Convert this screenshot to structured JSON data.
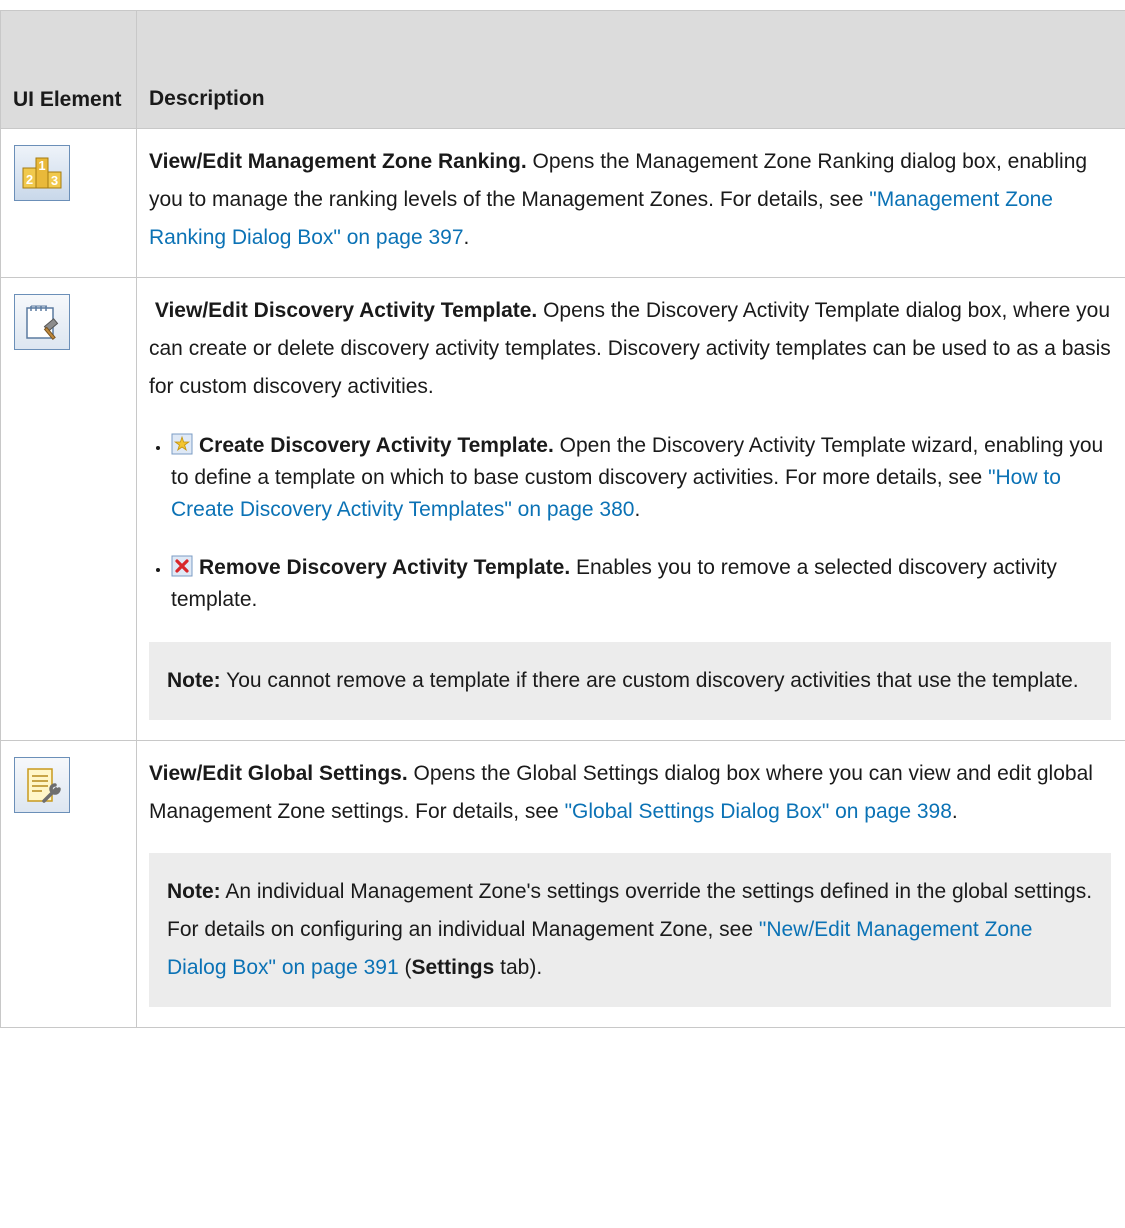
{
  "header": {
    "col1": "UI Element",
    "col2": "Description"
  },
  "rows": [
    {
      "icon": "ranking-icon",
      "title": "View/Edit Management Zone Ranking.",
      "text": " Opens the Management Zone Ranking dialog box, enabling you to manage the ranking levels of the Management Zones. For details, see ",
      "link": "\"Management Zone Ranking Dialog Box\" on page 397",
      "tail": "."
    },
    {
      "icon": "discovery-template-icon",
      "title": "View/Edit Discovery Activity Template.",
      "text": " Opens the Discovery Activity Template dialog box, where you can create or delete discovery activity templates. Discovery activity templates can be used to as a basis for custom discovery activities.",
      "items": [
        {
          "icon": "create-star-icon",
          "title": "Create Discovery Activity Template.",
          "text": " Open the Discovery Activity Template wizard, enabling you to define a template on which to base custom discovery activities. For more details, see ",
          "link": "\"How to Create Discovery Activity Templates\" on page 380",
          "tail": "."
        },
        {
          "icon": "remove-x-icon",
          "title": "Remove Discovery Activity Template.",
          "text": " Enables you to remove a selected discovery activity template."
        }
      ],
      "note": {
        "label": "Note:",
        "text": " You cannot remove a template if there are custom discovery activities that use the template."
      }
    },
    {
      "icon": "global-settings-icon",
      "title": "View/Edit Global Settings.",
      "text": " Opens the Global Settings dialog box where you can view and edit global Management Zone settings. For details, see ",
      "link": "\"Global Settings Dialog Box\" on page 398",
      "tail": ".",
      "note": {
        "label": "Note:",
        "text": " An individual Management Zone's settings override the settings defined in the global settings. For details on configuring an individual Management Zone, see ",
        "link": "\"New/Edit Management Zone Dialog Box\" on page 391",
        "mid": " (",
        "bold": "Settings",
        "tail": " tab)."
      }
    }
  ]
}
